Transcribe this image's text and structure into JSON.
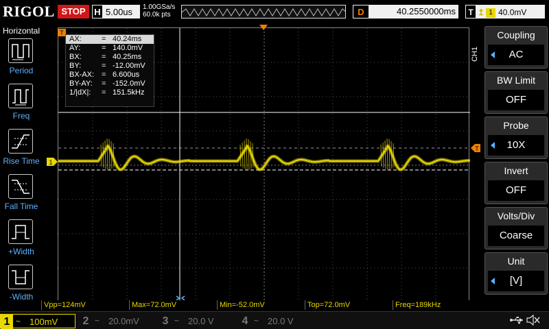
{
  "header": {
    "brand": "RIGOL",
    "run_status": "STOP",
    "timebase_label": "H",
    "timebase_value": "5.00us",
    "sample_rate": "1.00GSa/s",
    "memory_depth": "60.0k pts",
    "delay_label": "D",
    "delay_value": "40.2550000ms",
    "trigger_label": "T",
    "trigger_edge": "↥",
    "trigger_source": "1",
    "trigger_level": "40.0mV"
  },
  "left_panel": {
    "title": "Horizontal",
    "items": [
      {
        "label": "Period",
        "icon": "period-icon"
      },
      {
        "label": "Freq",
        "icon": "freq-icon"
      },
      {
        "label": "Rise Time",
        "icon": "rise-time-icon"
      },
      {
        "label": "Fall Time",
        "icon": "fall-time-icon"
      },
      {
        "label": "+Width",
        "icon": "positive-width-icon"
      },
      {
        "label": "-Width",
        "icon": "negative-width-icon"
      }
    ]
  },
  "cursor_readout": {
    "rows": [
      {
        "key": "AX:",
        "eq": "=",
        "value": "40.24ms"
      },
      {
        "key": "AY:",
        "eq": "=",
        "value": "140.0mV"
      },
      {
        "key": "BX:",
        "eq": "=",
        "value": "40.25ms"
      },
      {
        "key": "BY:",
        "eq": "=",
        "value": "-12.00mV"
      },
      {
        "key": "BX-AX:",
        "eq": "=",
        "value": "6.600us"
      },
      {
        "key": "BY-AY:",
        "eq": "=",
        "value": "-152.0mV"
      },
      {
        "key": "1/|dX|:",
        "eq": "=",
        "value": "151.5kHz"
      }
    ]
  },
  "waveform": {
    "channel_marker": "1",
    "trigger_marker": "T",
    "color": "#e8d800"
  },
  "measurements": [
    {
      "label": "Vpp=124mV"
    },
    {
      "label": "Max=72.0mV"
    },
    {
      "label": "Min=-52.0mV"
    },
    {
      "label": "Top=72.0mV"
    },
    {
      "label": "Freq=189kHz"
    }
  ],
  "channels": [
    {
      "num": "1",
      "coupling": "~",
      "scale": "100mV",
      "state": "active"
    },
    {
      "num": "2",
      "coupling": "~",
      "scale": "20.0mV",
      "state": "off"
    },
    {
      "num": "3",
      "coupling": "~",
      "scale": "20.0 V",
      "state": "off"
    },
    {
      "num": "4",
      "coupling": "~",
      "scale": "20.0 V",
      "state": "off"
    }
  ],
  "right_panel": {
    "channel_tag": "CH1",
    "items": [
      {
        "title": "Coupling",
        "value": "AC"
      },
      {
        "title": "BW Limit",
        "value": "OFF"
      },
      {
        "title": "Probe",
        "value": "10X"
      },
      {
        "title": "Invert",
        "value": "OFF"
      },
      {
        "title": "Volts/Div",
        "value": "Coarse"
      },
      {
        "title": "Unit",
        "value": "[V]"
      }
    ]
  },
  "status_icons": {
    "usb": "usb-icon",
    "speaker": "speaker-muted-icon"
  }
}
